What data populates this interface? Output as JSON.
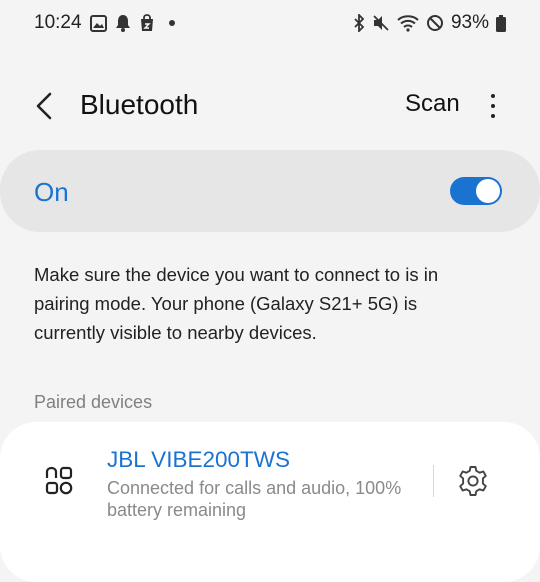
{
  "status_bar": {
    "time": "10:24",
    "battery": "93%",
    "left_icons": [
      "gallery-icon",
      "bell-icon",
      "shopping-bag-icon",
      "notification-dot-icon"
    ],
    "right_icons": [
      "bluetooth-icon",
      "mute-icon",
      "wifi-icon",
      "do-not-disturb-icon",
      "battery-icon"
    ]
  },
  "header": {
    "title": "Bluetooth",
    "scan_label": "Scan",
    "back_icon": "chevron-left-icon",
    "more_icon": "more-vertical-icon"
  },
  "toggle": {
    "label": "On",
    "state": true
  },
  "description": "Make sure the device you want to connect to is in pairing mode. Your phone (Galaxy S21+ 5G) is currently visible to nearby devices.",
  "paired": {
    "section_title": "Paired devices",
    "devices": [
      {
        "name": "JBL VIBE200TWS",
        "status": "Connected for calls and audio, 100% battery remaining",
        "icon": "earbuds-icon",
        "settings_icon": "gear-icon"
      }
    ]
  },
  "colors": {
    "accent": "#1a73d1",
    "background": "#f4f4f4",
    "card": "#ffffff",
    "toggle_card": "#e6e6e6"
  }
}
